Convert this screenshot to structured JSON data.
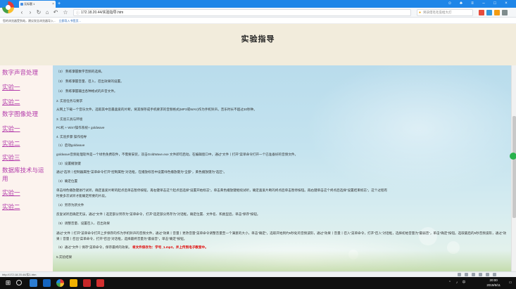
{
  "browser": {
    "tab_title": "无标题 1",
    "tab_close": "×",
    "new_tab": "+",
    "address_url": "172.18.20.44/实验指导.htm",
    "search_placeholder": "男孩借毛毛虫给大灯",
    "info_text": "您的浏览器受到劫，建议发告浏览器导入...",
    "info_link": "立即导入书签页..."
  },
  "page": {
    "title": "实验指导",
    "sidebar": [
      {
        "label": "数字声音处理",
        "link": false
      },
      {
        "label": "实验一",
        "link": true
      },
      {
        "label": "实验二",
        "link": true
      },
      {
        "label": "数字图像处理",
        "link": false
      },
      {
        "label": "实验一",
        "link": true
      },
      {
        "label": "实验二",
        "link": true
      },
      {
        "label": "实验三",
        "link": true
      },
      {
        "label": "数据库技术与运",
        "link": false
      },
      {
        "label": "用",
        "link": false
      },
      {
        "label": "实验一",
        "link": true
      },
      {
        "label": "实验二",
        "link": true
      }
    ],
    "content_lines": [
      "（2） 熟练掌握数字音频的选择。",
      "（3） 熟练掌握音量、召入、召出效果的设置。",
      "（4） 熟练掌握输出各种格式的声音文件。",
      "2. 实验任务与要求",
      "从网上下载一个音乐文件，选取其中您最喜爱的片断，将其保存成手机要求的音频格式(MP3或WAV)作为手机铃声。音乐时长不超过30秒钟。",
      "3. 实验工具与环境",
      "PC机 + Win7操作系统+ goldwave",
      "4. 实验步骤 操作指导",
      "（1）启动goldwave",
      "goldwave音频处理软件是一个绿色免费软件，不需要安装，双击GoldWave.exe 文件即可启动。在编辑窗口中，通过“文件丨打开”菜单命令打开一个已准备好的音频文件。",
      "（2）设置播放键",
      "通过“选项丨控制器属性”菜单命令打开“控制属性”对话框，在播放标签中设置绿色播放键为“全部”，黄色播放键为“选区”。",
      "（3）确定位置",
      "单击绿色播放键进行试听，确定喜爱片断的起点后单击暂停按钮，再右键单击这个起点后选择“设置开始标志”。单击黄色播放键继续试听，确定喜爱片断的终点后单击暂停按钮。再右键单击这个终点后选择“设置结束标志”。这个过程有",
      "时要多次试听才能确定所要的片段。",
      "（4）另存为新文件",
      "反复试听后确定无误，通过“文件丨选定部分另存为”菜单命令，打开“选定部分另存为”对话框，确定位置、文件名、和类型后，单击“保存”按钮。",
      "（5）调整音量、设置召入、召出效果",
      "通过“文件丨打开”菜单命令打开上步保存的作为手机铃声的音频文件，通过“效果丨音量丨更改音量”菜单命令调整音量至一个满意的大小，单击“确定”。选取开始到约5秒处的音频波形，通过“效果丨音量丨召入”菜单命令，打开“召入”对话框，选择初始音量为“最弱音”，单击“确定”按钮。选取最后的5秒音频波形，通过“效果丨音量丨召出”菜单命令，打开“召出”对话框，选择最终音量为“最弱音”，单击“确定”按钮。",
      "（6）通过“文件丨保存”菜单命令，保存最终的效果。"
    ],
    "highlight_prefix": "（6）通过“文件丨保存”菜单命令，保存最终的效果。",
    "highlight_text": "将文件保存为：学号_1.mp3，并上传到电子教室中。",
    "last_line": "5.实验结果"
  },
  "statusbar": {
    "url": "http://172.18.20.44/实1.htm"
  },
  "taskbar": {
    "time": "20:00",
    "date": "2019/5/11"
  },
  "colors": {
    "tab_strip": "#1f86e8",
    "sidebar_text": "#b43cab",
    "highlight": "#e00000",
    "header_bg": "#f2ecdc",
    "sidebar_bg": "#fcf3ee"
  },
  "icons": [
    "back-icon",
    "forward-icon",
    "refresh-icon",
    "home-icon",
    "undo-icon",
    "star-icon",
    "search-icon",
    "settings-icon"
  ]
}
